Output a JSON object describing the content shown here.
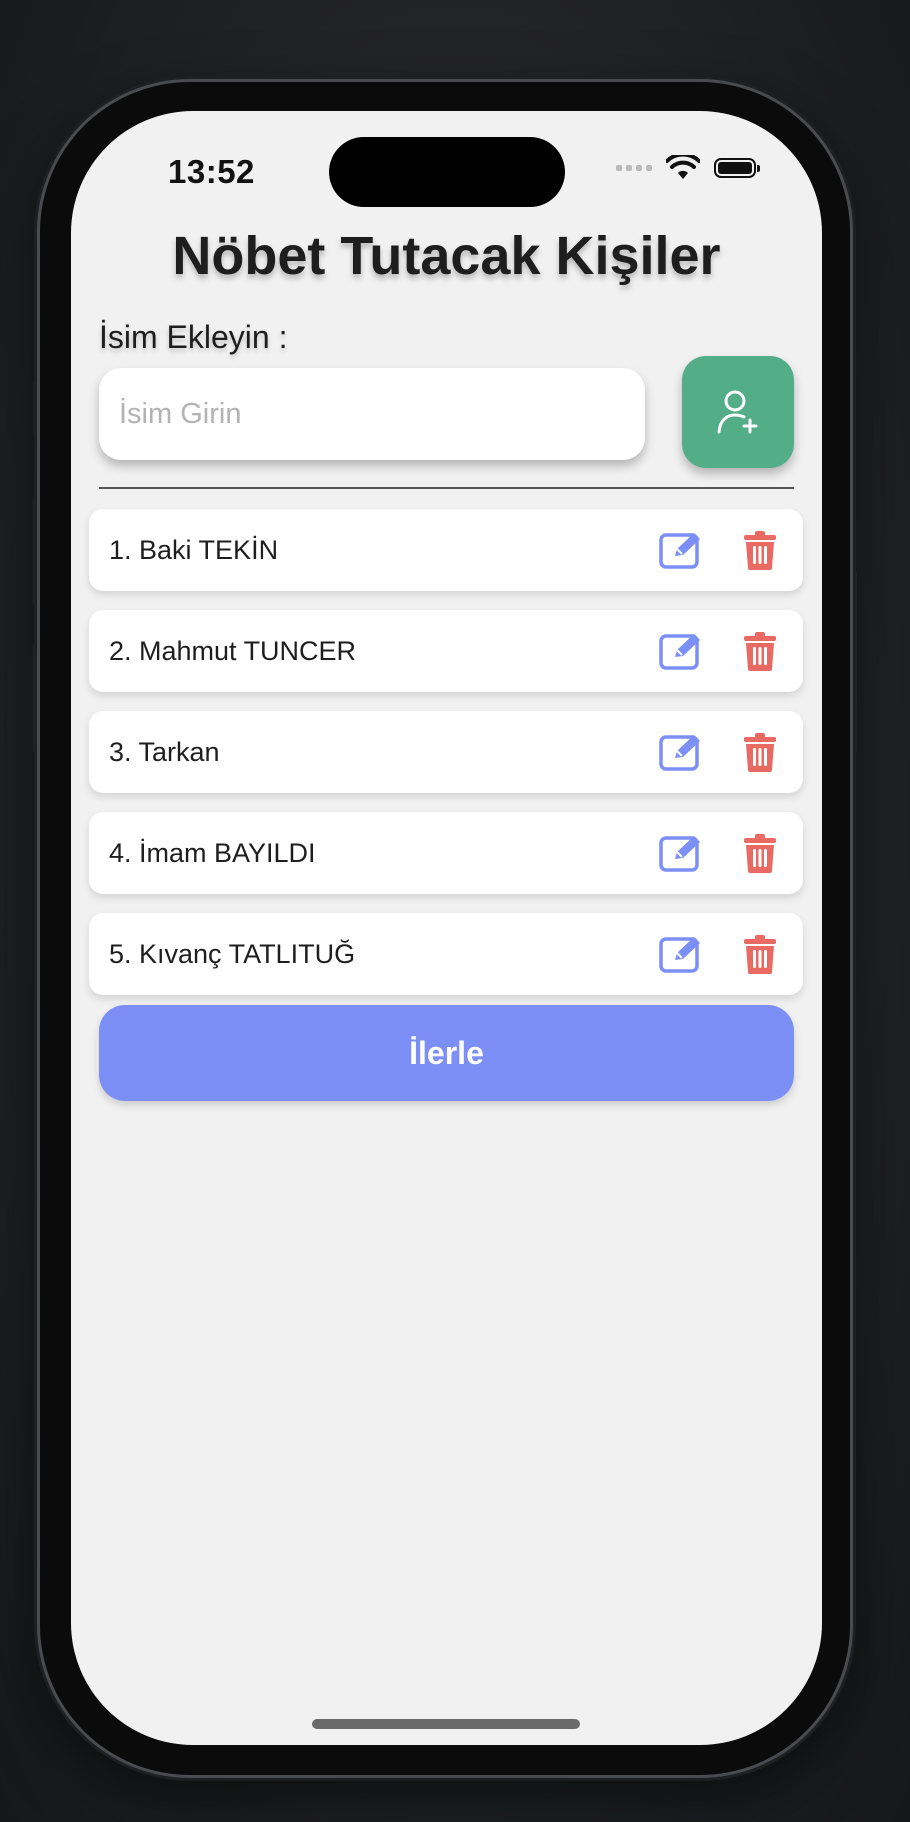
{
  "status_bar": {
    "time": "13:52"
  },
  "header": {
    "title": "Nöbet Tutacak Kişiler"
  },
  "form": {
    "label": "İsim Ekleyin :",
    "input_placeholder": "İsim Girin",
    "input_value": "",
    "add_button_icon": "add-user-icon"
  },
  "people": [
    {
      "label": "1. Baki TEKİN"
    },
    {
      "label": "2. Mahmut TUNCER"
    },
    {
      "label": "3. Tarkan"
    },
    {
      "label": "4. İmam BAYILDI"
    },
    {
      "label": "5. Kıvanç TATLITUĞ"
    }
  ],
  "icons": {
    "edit": "edit-icon",
    "delete": "trash-icon"
  },
  "proceed_button": {
    "label": "İlerle"
  },
  "colors": {
    "add_button": "#53ad87",
    "edit_icon": "#7b8ff6",
    "delete_icon": "#e96a63",
    "proceed_button": "#7b8ff6",
    "screen_background": "#f1f1f1"
  }
}
